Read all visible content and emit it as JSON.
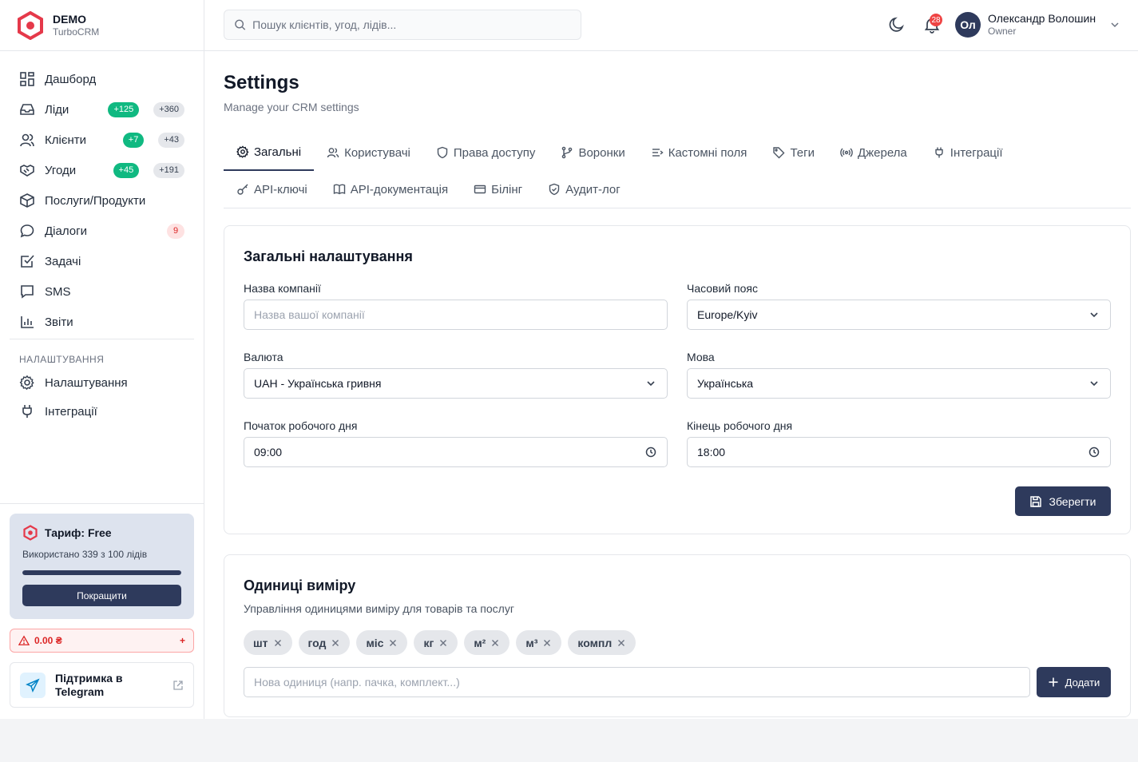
{
  "brand": {
    "name": "DEMO",
    "subtitle": "TurboCRM"
  },
  "colors": {
    "primary": "#2e3a5c",
    "brand_red": "#e5394a",
    "success": "#10b981",
    "danger": "#dc2626"
  },
  "nav": {
    "items": [
      {
        "label": "Дашборд",
        "icon": "dashboard-icon"
      },
      {
        "label": "Ліди",
        "icon": "inbox-icon",
        "badge_new": "+125",
        "badge_total": "+360"
      },
      {
        "label": "Клієнти",
        "icon": "users-icon",
        "badge_new": "+7",
        "badge_total": "+43"
      },
      {
        "label": "Угоди",
        "icon": "handshake-icon",
        "badge_new": "+45",
        "badge_total": "+191"
      },
      {
        "label": "Послуги/Продукти",
        "icon": "box-icon"
      },
      {
        "label": "Діалоги",
        "icon": "chat-icon",
        "badge_alert": "9"
      },
      {
        "label": "Задачі",
        "icon": "task-icon"
      },
      {
        "label": "SMS",
        "icon": "message-icon"
      },
      {
        "label": "Звіти",
        "icon": "chart-icon"
      }
    ],
    "section_title": "НАЛАШТУВАННЯ",
    "settings_items": [
      {
        "label": "Налаштування",
        "icon": "gear-icon"
      },
      {
        "label": "Інтеграції",
        "icon": "plug-icon"
      }
    ]
  },
  "plan": {
    "title": "Тариф: Free",
    "usage": "Використано 339 з 100 лідів",
    "usage_fraction": 1.0,
    "upgrade_label": "Покращити"
  },
  "balance": {
    "amount": "0.00 ₴",
    "add": "+"
  },
  "support": {
    "label": "Підтримка в Telegram"
  },
  "header": {
    "search_placeholder": "Пошук клієнтів, угод, лідів...",
    "notifications_count": "28",
    "user": {
      "initials": "Ол",
      "name": "Олександр Волошин",
      "role": "Owner"
    }
  },
  "page": {
    "title": "Settings",
    "subtitle": "Manage your CRM settings",
    "tabs_row1": [
      {
        "label": "Загальні",
        "icon": "gear-icon",
        "active": true
      },
      {
        "label": "Користувачі",
        "icon": "users-icon"
      },
      {
        "label": "Права доступу",
        "icon": "shield-icon"
      },
      {
        "label": "Воронки",
        "icon": "branch-icon"
      },
      {
        "label": "Кастомні поля",
        "icon": "list-icon"
      },
      {
        "label": "Теги",
        "icon": "tag-icon"
      },
      {
        "label": "Джерела",
        "icon": "radio-icon"
      },
      {
        "label": "Інтеграції",
        "icon": "plug-icon"
      }
    ],
    "tabs_row2": [
      {
        "label": "API-ключі",
        "icon": "key-icon"
      },
      {
        "label": "API-документація",
        "icon": "book-icon"
      },
      {
        "label": "Білінг",
        "icon": "card-icon"
      },
      {
        "label": "Аудит-лог",
        "icon": "shield-check-icon"
      }
    ]
  },
  "general": {
    "title": "Загальні налаштування",
    "company_label": "Назва компанії",
    "company_value": "",
    "company_placeholder": "Назва вашої компанії",
    "timezone_label": "Часовий пояс",
    "timezone_value": "Europe/Kyiv",
    "currency_label": "Валюта",
    "currency_value": "UAH - Українська гривня",
    "language_label": "Мова",
    "language_value": "Українська",
    "start_label": "Початок робочого дня",
    "start_value": "09:00",
    "end_label": "Кінець робочого дня",
    "end_value": "18:00",
    "save_label": "Зберегти"
  },
  "units": {
    "title": "Одиниці виміру",
    "subtitle": "Управління одиницями виміру для товарів та послуг",
    "chips": [
      "шт",
      "год",
      "міс",
      "кг",
      "м²",
      "м³",
      "компл"
    ],
    "input_placeholder": "Нова одиниця (напр. пачка, комплект...)",
    "add_label": "Додати"
  }
}
